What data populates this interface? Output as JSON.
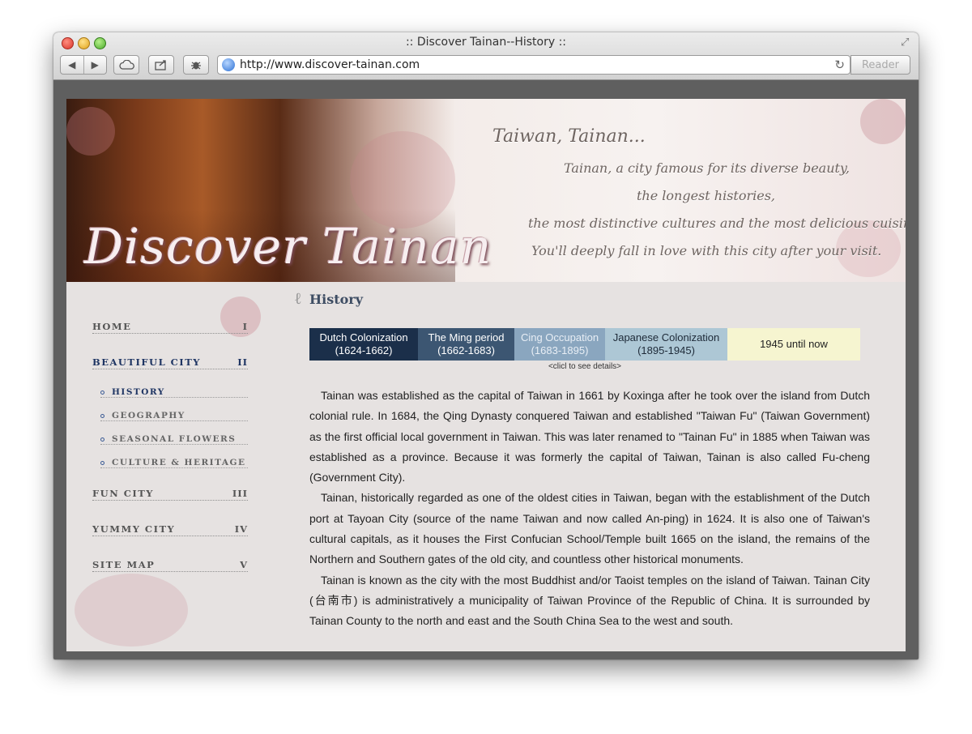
{
  "browser": {
    "window_title": ":: Discover Tainan--History ::",
    "url": "http://www.discover-tainan.com",
    "reader_label": "Reader"
  },
  "banner": {
    "logo_text": "Discover Tainan",
    "lines": [
      "Taiwan, Tainan...",
      "Tainan, a city famous for its diverse beauty,",
      "the longest histories,",
      "the most distinctive cultures and the most delicious cuisine.",
      "You'll deeply fall in love with this city after your visit."
    ]
  },
  "nav": {
    "home": {
      "label": "HOME",
      "num": "I"
    },
    "beautiful": {
      "label": "BEAUTIFUL CITY",
      "num": "II"
    },
    "sub": [
      "HISTORY",
      "GEOGRAPHY",
      "SEASONAL FLOWERS",
      "CULTURE & HERITAGE"
    ],
    "fun": {
      "label": "FUN CITY",
      "num": "III"
    },
    "yummy": {
      "label": "YUMMY CITY",
      "num": "IV"
    },
    "sitemap": {
      "label": "SITE MAP",
      "num": "V"
    }
  },
  "content": {
    "title": "History",
    "timeline": [
      {
        "name": "Dutch Colonization",
        "years": "(1624-1662)"
      },
      {
        "name": "The Ming period",
        "years": "(1662-1683)"
      },
      {
        "name": "Cing Occupation",
        "years": "(1683-1895)"
      },
      {
        "name": "Japanese Colonization",
        "years": "(1895-1945)"
      },
      {
        "name": "1945 until now",
        "years": ""
      }
    ],
    "timeline_hint": "<clicl to see details>",
    "paragraphs": [
      "Tainan was established as the capital of Taiwan in 1661 by Koxinga after he took over the island from Dutch colonial rule. In 1684, the Qing Dynasty conquered Taiwan and established \"Taiwan Fu\" (Taiwan Government) as the first official local government in Taiwan. This was later renamed to \"Tainan Fu\" in 1885 when Taiwan was established as a province. Because it was formerly the capital of Taiwan, Tainan is also called Fu-cheng (Government City).",
      "Tainan, historically regarded as one of the oldest cities in Taiwan, began with the establishment of the Dutch port at Tayoan City (source of the name Taiwan and now called An-ping) in 1624. It is also one of Taiwan's cultural capitals, as it houses the First Confucian School/Temple built 1665 on the island, the remains of the Northern and Southern gates of the old city, and countless other historical monuments.",
      "Tainan is known as the city with the most Buddhist and/or Taoist temples on the island of Taiwan. Tainan City (台南市) is administratively a municipality of Taiwan Province of the Republic of China. It is surrounded by Tainan County to the north and east and the South China Sea to the west and south."
    ]
  }
}
